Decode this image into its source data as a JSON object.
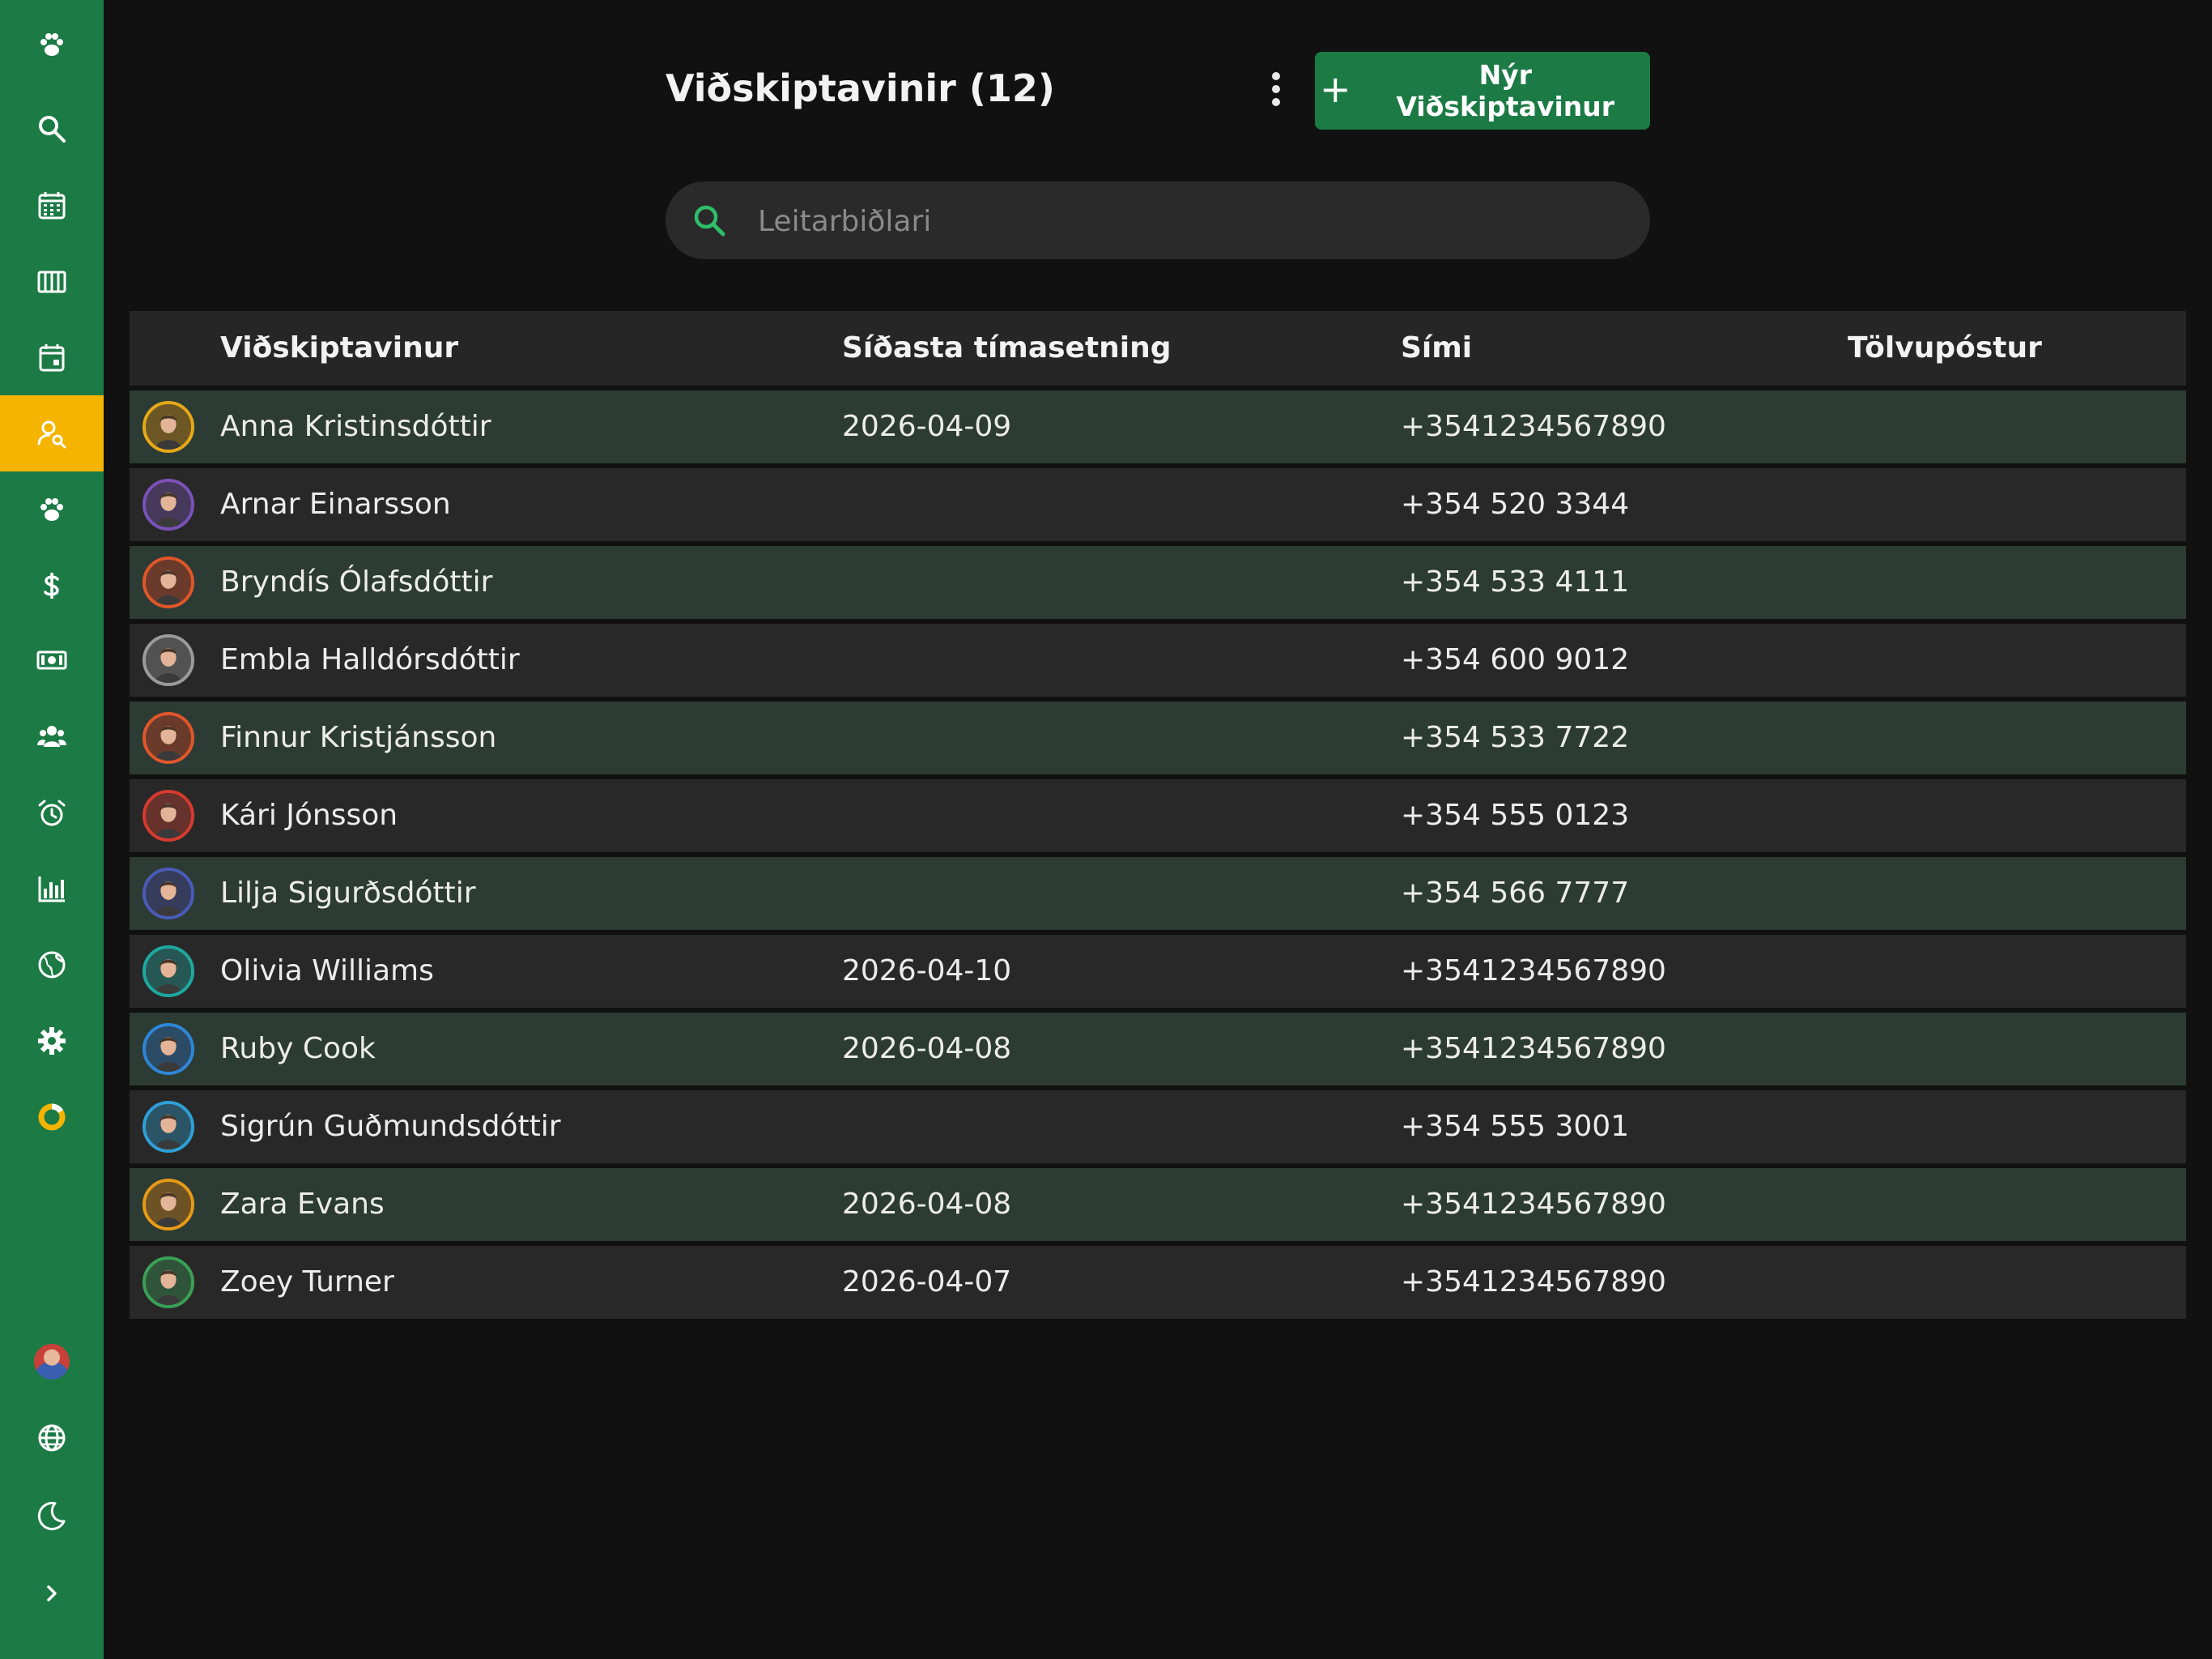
{
  "app": {
    "sidebar": {
      "items": [
        {
          "icon": "paw-logo-icon"
        },
        {
          "icon": "search-icon"
        },
        {
          "icon": "calendar-grid-icon"
        },
        {
          "icon": "columns-icon"
        },
        {
          "icon": "calendar-day-icon"
        },
        {
          "icon": "customer-search-icon",
          "active": true
        },
        {
          "icon": "paw-icon"
        },
        {
          "icon": "dollar-icon"
        },
        {
          "icon": "cash-icon"
        },
        {
          "icon": "users-icon"
        },
        {
          "icon": "alarm-icon"
        },
        {
          "icon": "bar-chart-icon"
        },
        {
          "icon": "globe-icon"
        },
        {
          "icon": "gear-icon"
        },
        {
          "icon": "loading-ring-icon"
        }
      ],
      "bottom": [
        {
          "icon": "user-avatar"
        },
        {
          "icon": "language-globe-icon"
        },
        {
          "icon": "moon-icon"
        },
        {
          "icon": "chevron-right-icon"
        }
      ],
      "accent": "#1c7a45",
      "active_color": "#f5b400"
    }
  },
  "header": {
    "title": "Viðskiptavinir (12)",
    "new_button_label": "Nýr Viðskiptavinur"
  },
  "search": {
    "placeholder": "Leitarbiðlari",
    "value": ""
  },
  "table": {
    "columns": [
      "Viðskiptavinur",
      "Síðasta tímasetning",
      "Sími",
      "Tölvupóstur"
    ],
    "rows": [
      {
        "name": "Anna Kristinsdóttir",
        "last": "2026-04-09",
        "phone": "+3541234567890",
        "email": "",
        "ring": "#e6a817"
      },
      {
        "name": "Arnar Einarsson",
        "last": "",
        "phone": "+354 520 3344",
        "email": "",
        "ring": "#7a52b8"
      },
      {
        "name": "Bryndís Ólafsdóttir",
        "last": "",
        "phone": "+354 533 4111",
        "email": "",
        "ring": "#e0562b"
      },
      {
        "name": "Embla Halldórsdóttir",
        "last": "",
        "phone": "+354 600 9012",
        "email": "",
        "ring": "#9a9a9a"
      },
      {
        "name": "Finnur Kristjánsson",
        "last": "",
        "phone": "+354 533 7722",
        "email": "",
        "ring": "#e0562b"
      },
      {
        "name": "Kári Jónsson",
        "last": "",
        "phone": "+354 555 0123",
        "email": "",
        "ring": "#d63b2e"
      },
      {
        "name": "Lilja Sigurðsdóttir",
        "last": "",
        "phone": "+354 566 7777",
        "email": "",
        "ring": "#4a5bb8"
      },
      {
        "name": "Olivia Williams",
        "last": "2026-04-10",
        "phone": "+3541234567890",
        "email": "",
        "ring": "#1fa8a0"
      },
      {
        "name": "Ruby Cook",
        "last": "2026-04-08",
        "phone": "+3541234567890",
        "email": "",
        "ring": "#2f86d6"
      },
      {
        "name": "Sigrún Guðmundsdóttir",
        "last": "",
        "phone": "+354 555 3001",
        "email": "",
        "ring": "#2fa0d6"
      },
      {
        "name": "Zara Evans",
        "last": "2026-04-08",
        "phone": "+3541234567890",
        "email": "",
        "ring": "#e69a17"
      },
      {
        "name": "Zoey Turner",
        "last": "2026-04-07",
        "phone": "+3541234567890",
        "email": "",
        "ring": "#3aa055"
      }
    ]
  }
}
